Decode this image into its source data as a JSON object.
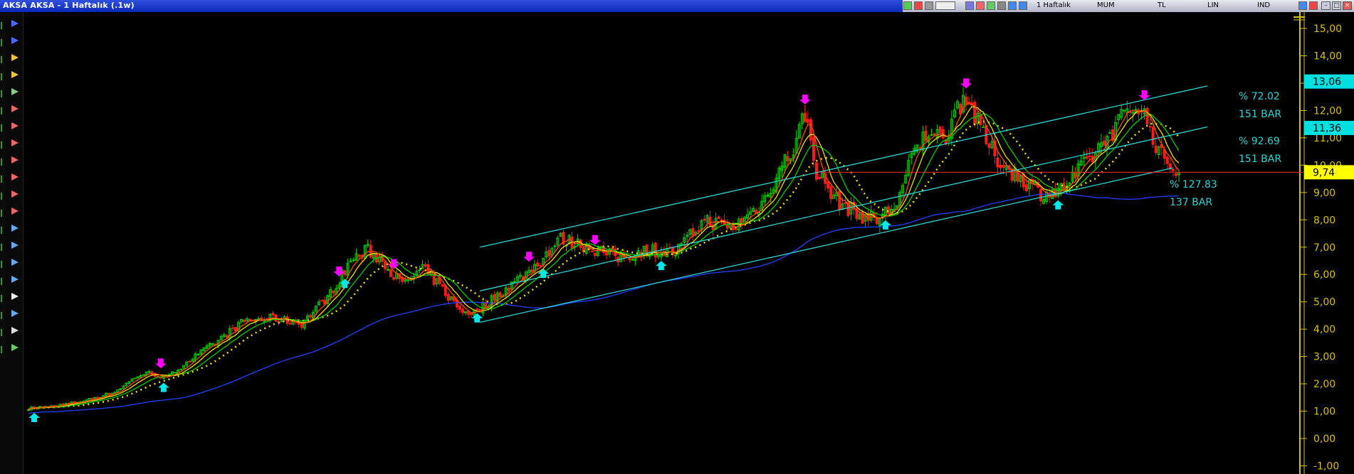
{
  "window": {
    "title": "AKSA AKSA - 1 Haftalık (.1w)"
  },
  "toolbar": {
    "period_label": "1 Haftalık",
    "style_label": "MUM",
    "currency_label": "TL",
    "scale_label": "LIN",
    "indicator_label": "IND"
  },
  "left_toolbar": {
    "tools": [
      "arrow-left-icon",
      "arrow-right-icon",
      "print-icon",
      "layers-icon",
      "pen-icon",
      "arrow-icon",
      "arrow-icon",
      "arrow-icon",
      "arrow-icon",
      "arrow-icon",
      "arrow-icon",
      "arrow-icon",
      "arrow-icon",
      "arrow-icon",
      "arrow-icon",
      "arrow-icon",
      "magnifier-icon",
      "move-icon",
      "clipboard-icon",
      "pen-icon"
    ]
  },
  "colors": {
    "background": "#000000",
    "axis": "#d8c000",
    "up_candle": "#00d000",
    "down_candle": "#ff1a1a",
    "channel": "#2ad4d4",
    "ma_fast": "#ff4a00",
    "ma_mid": "#f0e000",
    "ma_slow": "#00d000",
    "ma_long": "#2040ff",
    "sell_arrow": "#ff00ff",
    "buy_arrow": "#00e8e8",
    "last_price_line": "#ff2020"
  },
  "chart_data": {
    "type": "candlestick",
    "y_axis_ticks": [
      "15,00",
      "14,00",
      "13,00",
      "12,00",
      "11,00",
      "10,00",
      "9,00",
      "8,00",
      "7,00",
      "6,00",
      "5,00",
      "4,00",
      "3,00",
      "2,00",
      "1,00",
      "0,00",
      "-1,00"
    ],
    "ylim": [
      -1.3,
      15.6
    ],
    "price_tags": [
      {
        "value": 13.06,
        "label": "13,06",
        "color": "#00e0e0"
      },
      {
        "value": 11.36,
        "label": "11,36",
        "color": "#00e0e0"
      },
      {
        "value": 9.74,
        "label": "9,74",
        "color": "#ffff00"
      }
    ],
    "last_price": 9.74,
    "channel_annotations": [
      {
        "pct": "% 72.02",
        "bars": "151 BAR"
      },
      {
        "pct": "% 92.69",
        "bars": "151 BAR"
      },
      {
        "pct": "% 127.83",
        "bars": "137 BAR"
      }
    ],
    "price_anchors": [
      [
        0,
        1.1
      ],
      [
        10,
        1.2
      ],
      [
        20,
        1.4
      ],
      [
        30,
        1.7
      ],
      [
        38,
        2.3
      ],
      [
        42,
        2.4
      ],
      [
        48,
        2.2
      ],
      [
        55,
        2.8
      ],
      [
        65,
        3.5
      ],
      [
        75,
        4.3
      ],
      [
        85,
        4.4
      ],
      [
        95,
        4.2
      ],
      [
        105,
        5.3
      ],
      [
        112,
        6.5
      ],
      [
        118,
        6.9
      ],
      [
        124,
        6.4
      ],
      [
        130,
        5.6
      ],
      [
        137,
        6.2
      ],
      [
        142,
        5.7
      ],
      [
        150,
        4.7
      ],
      [
        155,
        4.6
      ],
      [
        165,
        5.4
      ],
      [
        175,
        6.2
      ],
      [
        185,
        7.3
      ],
      [
        195,
        7.0
      ],
      [
        205,
        6.6
      ],
      [
        215,
        6.9
      ],
      [
        225,
        6.8
      ],
      [
        235,
        8.0
      ],
      [
        245,
        7.7
      ],
      [
        255,
        8.6
      ],
      [
        262,
        10.0
      ],
      [
        266,
        10.6
      ],
      [
        270,
        11.9
      ],
      [
        274,
        9.8
      ],
      [
        280,
        8.8
      ],
      [
        288,
        8.2
      ],
      [
        295,
        8.0
      ],
      [
        302,
        8.6
      ],
      [
        308,
        10.5
      ],
      [
        314,
        11.4
      ],
      [
        318,
        10.8
      ],
      [
        322,
        12.0
      ],
      [
        326,
        12.6
      ],
      [
        330,
        11.5
      ],
      [
        336,
        10.3
      ],
      [
        344,
        9.6
      ],
      [
        352,
        9.0
      ],
      [
        358,
        9.0
      ],
      [
        364,
        9.6
      ],
      [
        372,
        10.6
      ],
      [
        380,
        11.7
      ],
      [
        386,
        12.3
      ],
      [
        390,
        11.3
      ],
      [
        394,
        10.3
      ],
      [
        400,
        9.74
      ]
    ],
    "ma_periods": [
      5,
      8,
      13,
      55,
      20
    ],
    "sell_signals": [
      46,
      108,
      127,
      174,
      197,
      270,
      326,
      388
    ],
    "buy_signals": [
      2,
      47,
      110,
      156,
      179,
      220,
      298,
      358
    ],
    "channels": [
      {
        "x": [
          157,
          410
        ],
        "y": [
          7.0,
          12.9
        ]
      },
      {
        "x": [
          157,
          410
        ],
        "y": [
          5.4,
          11.4
        ]
      },
      {
        "x": [
          157,
          398
        ],
        "y": [
          4.25,
          9.9
        ]
      }
    ]
  }
}
